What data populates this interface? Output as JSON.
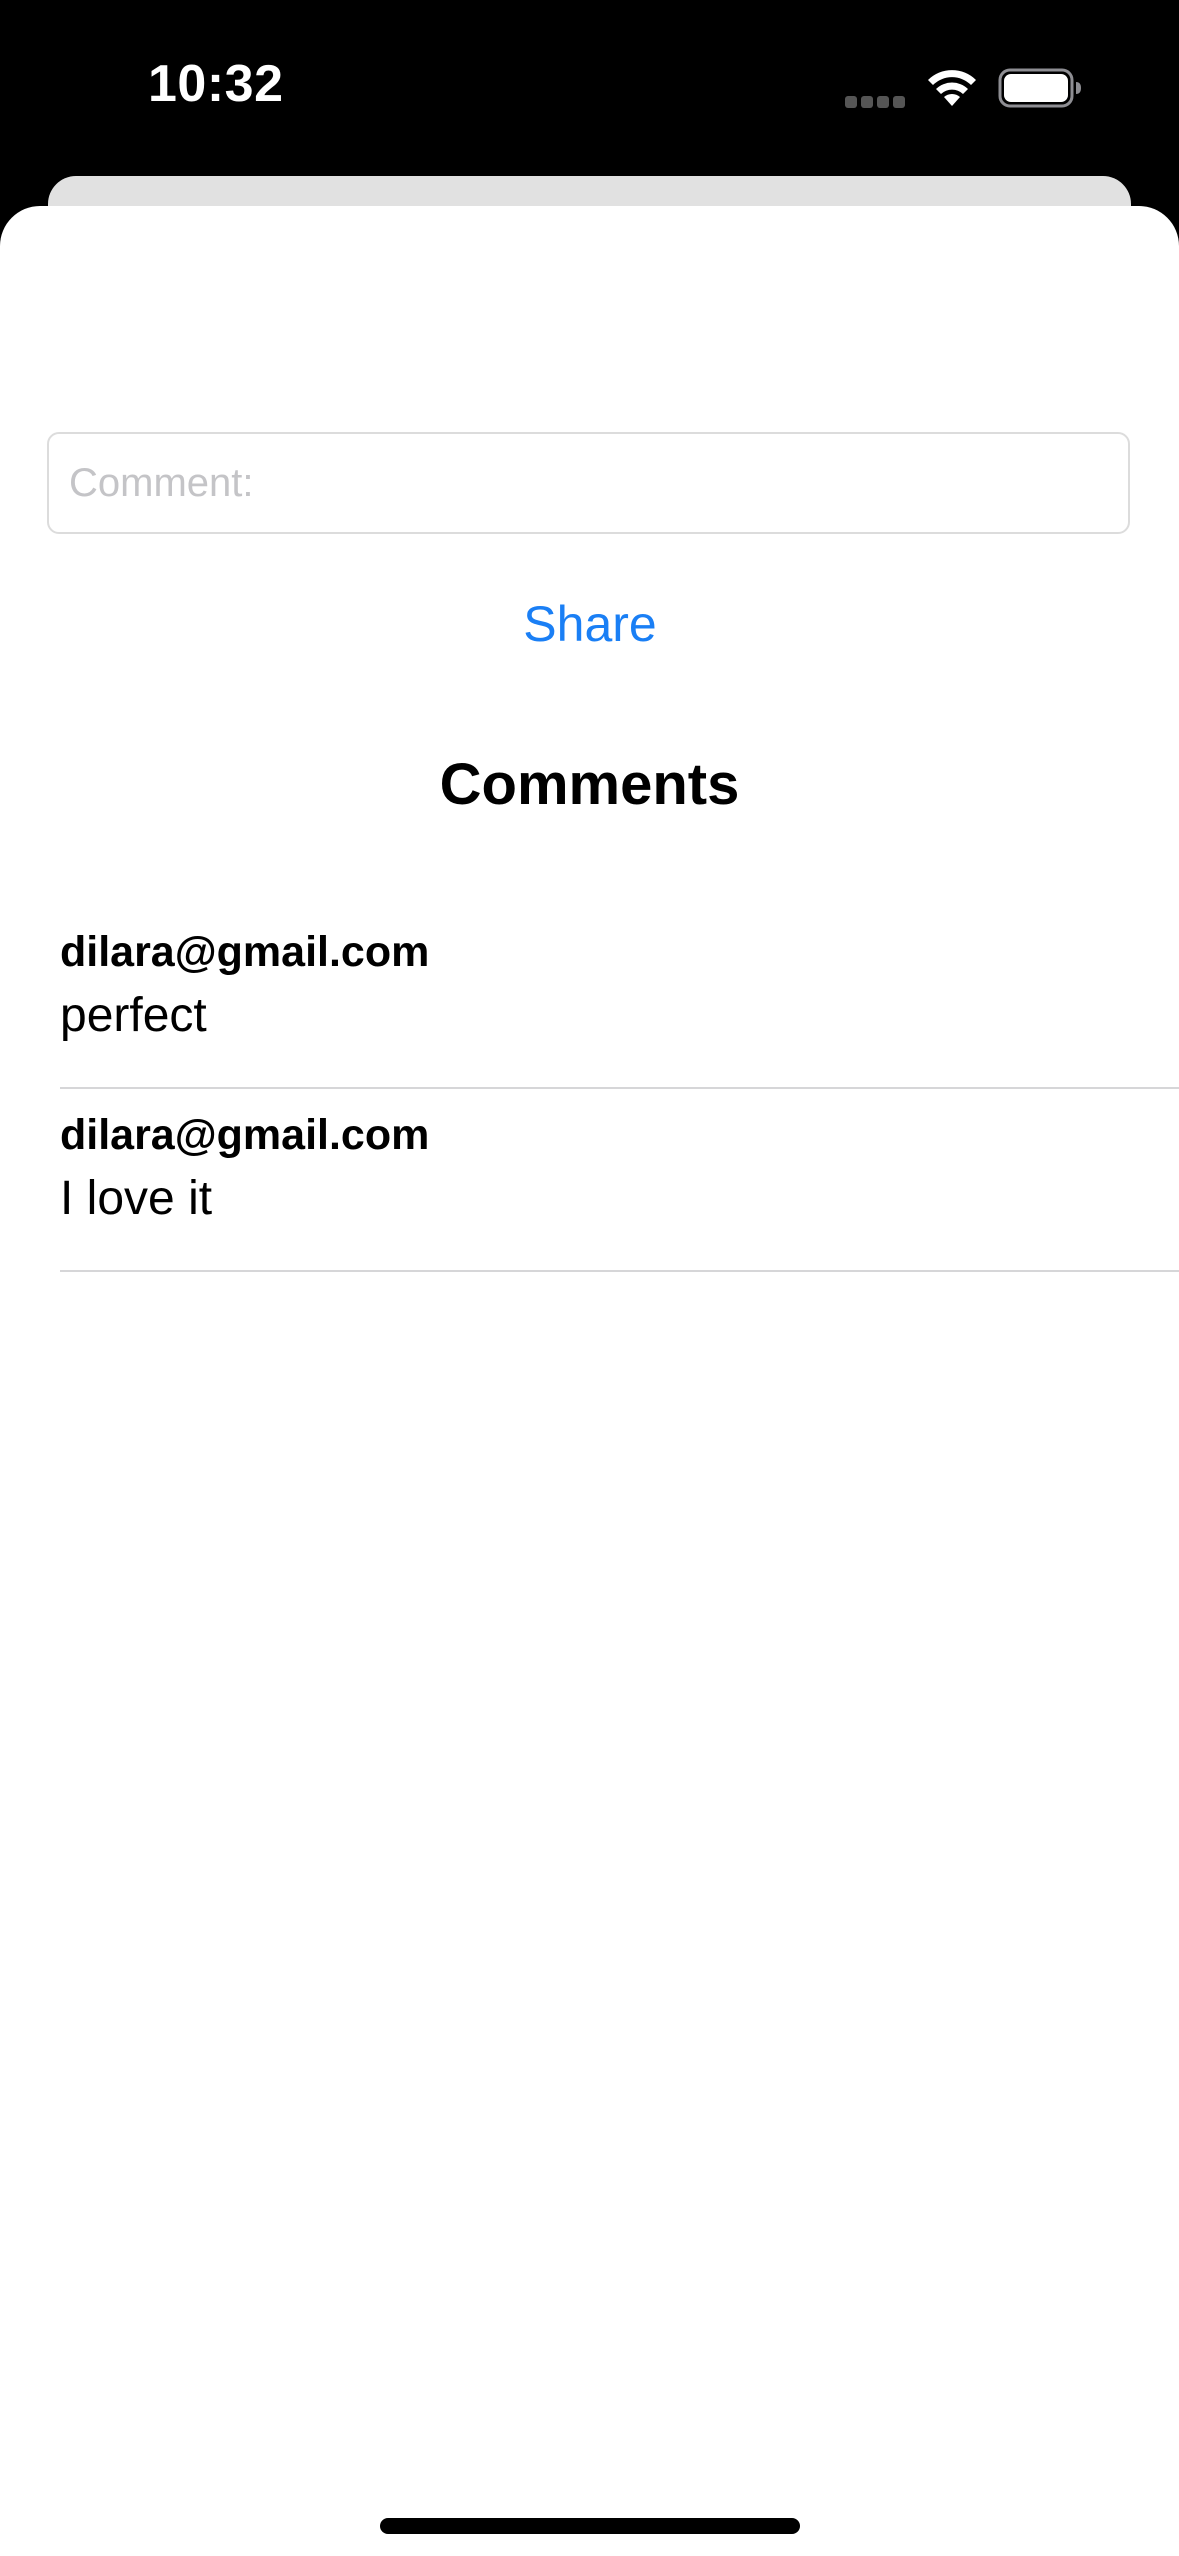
{
  "status_bar": {
    "time": "10:32",
    "wifi_icon": "wifi-icon",
    "battery_icon": "battery-icon",
    "signal_icon": "cellular-signal-icon"
  },
  "form": {
    "comment_placeholder": "Comment:",
    "comment_value": "",
    "share_label": "Share"
  },
  "comments_section": {
    "title": "Comments",
    "items": [
      {
        "author": "dilara@gmail.com",
        "text": "perfect"
      },
      {
        "author": "dilara@gmail.com",
        "text": "I love it"
      }
    ]
  },
  "colors": {
    "accent": "#1a7ff5",
    "placeholder": "#c4c4c7",
    "separator": "#d6d6d8"
  }
}
